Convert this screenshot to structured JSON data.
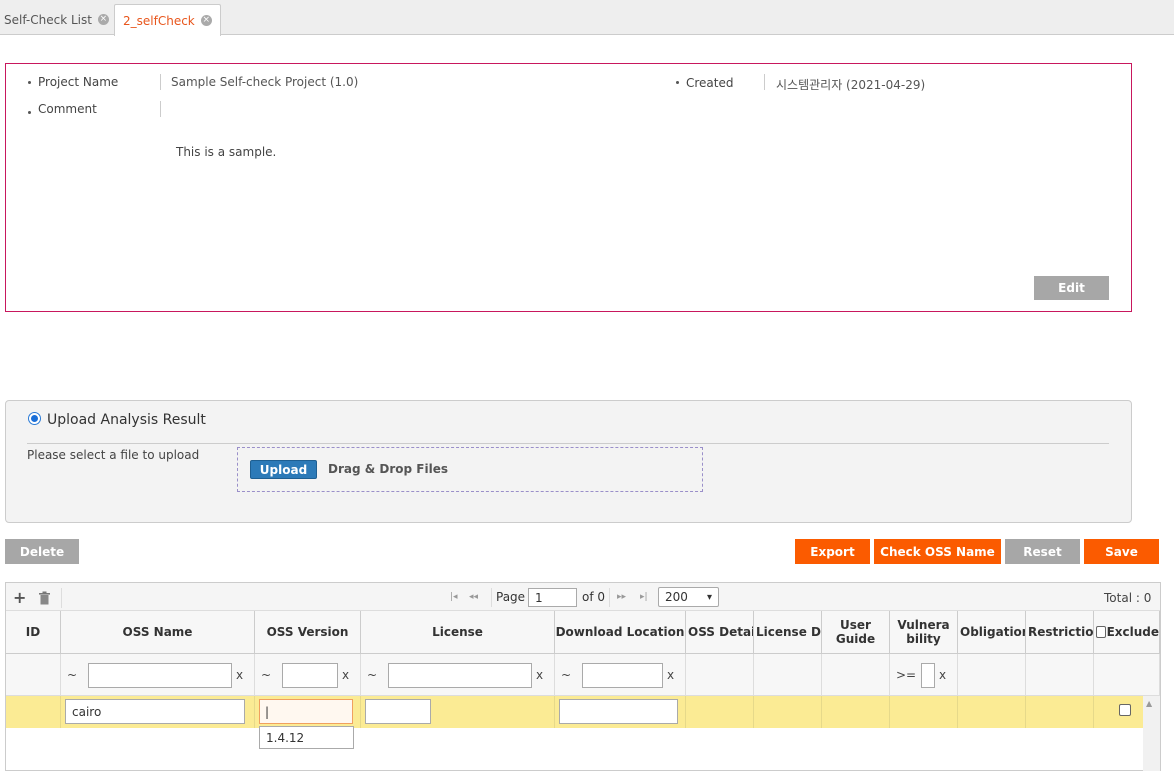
{
  "tabs": [
    {
      "label": "Self-Check List",
      "close": "×"
    },
    {
      "label": "2_selfCheck",
      "close": "×"
    }
  ],
  "project": {
    "name_label": "Project Name",
    "name_value": "Sample Self-check Project (1.0)",
    "created_label": "Created",
    "created_value": "시스템관리자 (2021-04-29)",
    "comment_label": "Comment",
    "comment_value": "This is a sample.",
    "edit_label": "Edit"
  },
  "upload": {
    "radio_label": "Upload Analysis Result",
    "prompt": "Please select a file to upload",
    "button_label": "Upload",
    "drop_label": "Drag & Drop Files"
  },
  "actions": {
    "delete": "Delete",
    "export": "Export",
    "check_oss": "Check OSS Name",
    "reset": "Reset",
    "save": "Save"
  },
  "grid": {
    "toolbar": {
      "add_icon": "+",
      "trash_icon": "trash",
      "page_label": "Page",
      "page_value": "1",
      "of_label": "of 0",
      "page_size": "200",
      "total": "Total : 0"
    },
    "headers": {
      "id": "ID",
      "oss_name": "OSS Name",
      "oss_version": "OSS Version",
      "license": "License",
      "download": "Download Location",
      "oss_detail": "OSS Detai",
      "license_detail": "License De",
      "user_guide_1": "User",
      "user_guide_2": "Guide",
      "vuln_1": "Vulnera",
      "vuln_2": "bility",
      "obligation": "Obligatior",
      "restriction": "Restrictio",
      "exclude": "Exclude"
    },
    "filter": {
      "tilde": "~",
      "clear": "x",
      "gte": ">="
    },
    "row": {
      "oss_name": "cairo",
      "oss_version": "|",
      "license": "",
      "download": ""
    },
    "autocomplete": "1.4.12"
  }
}
